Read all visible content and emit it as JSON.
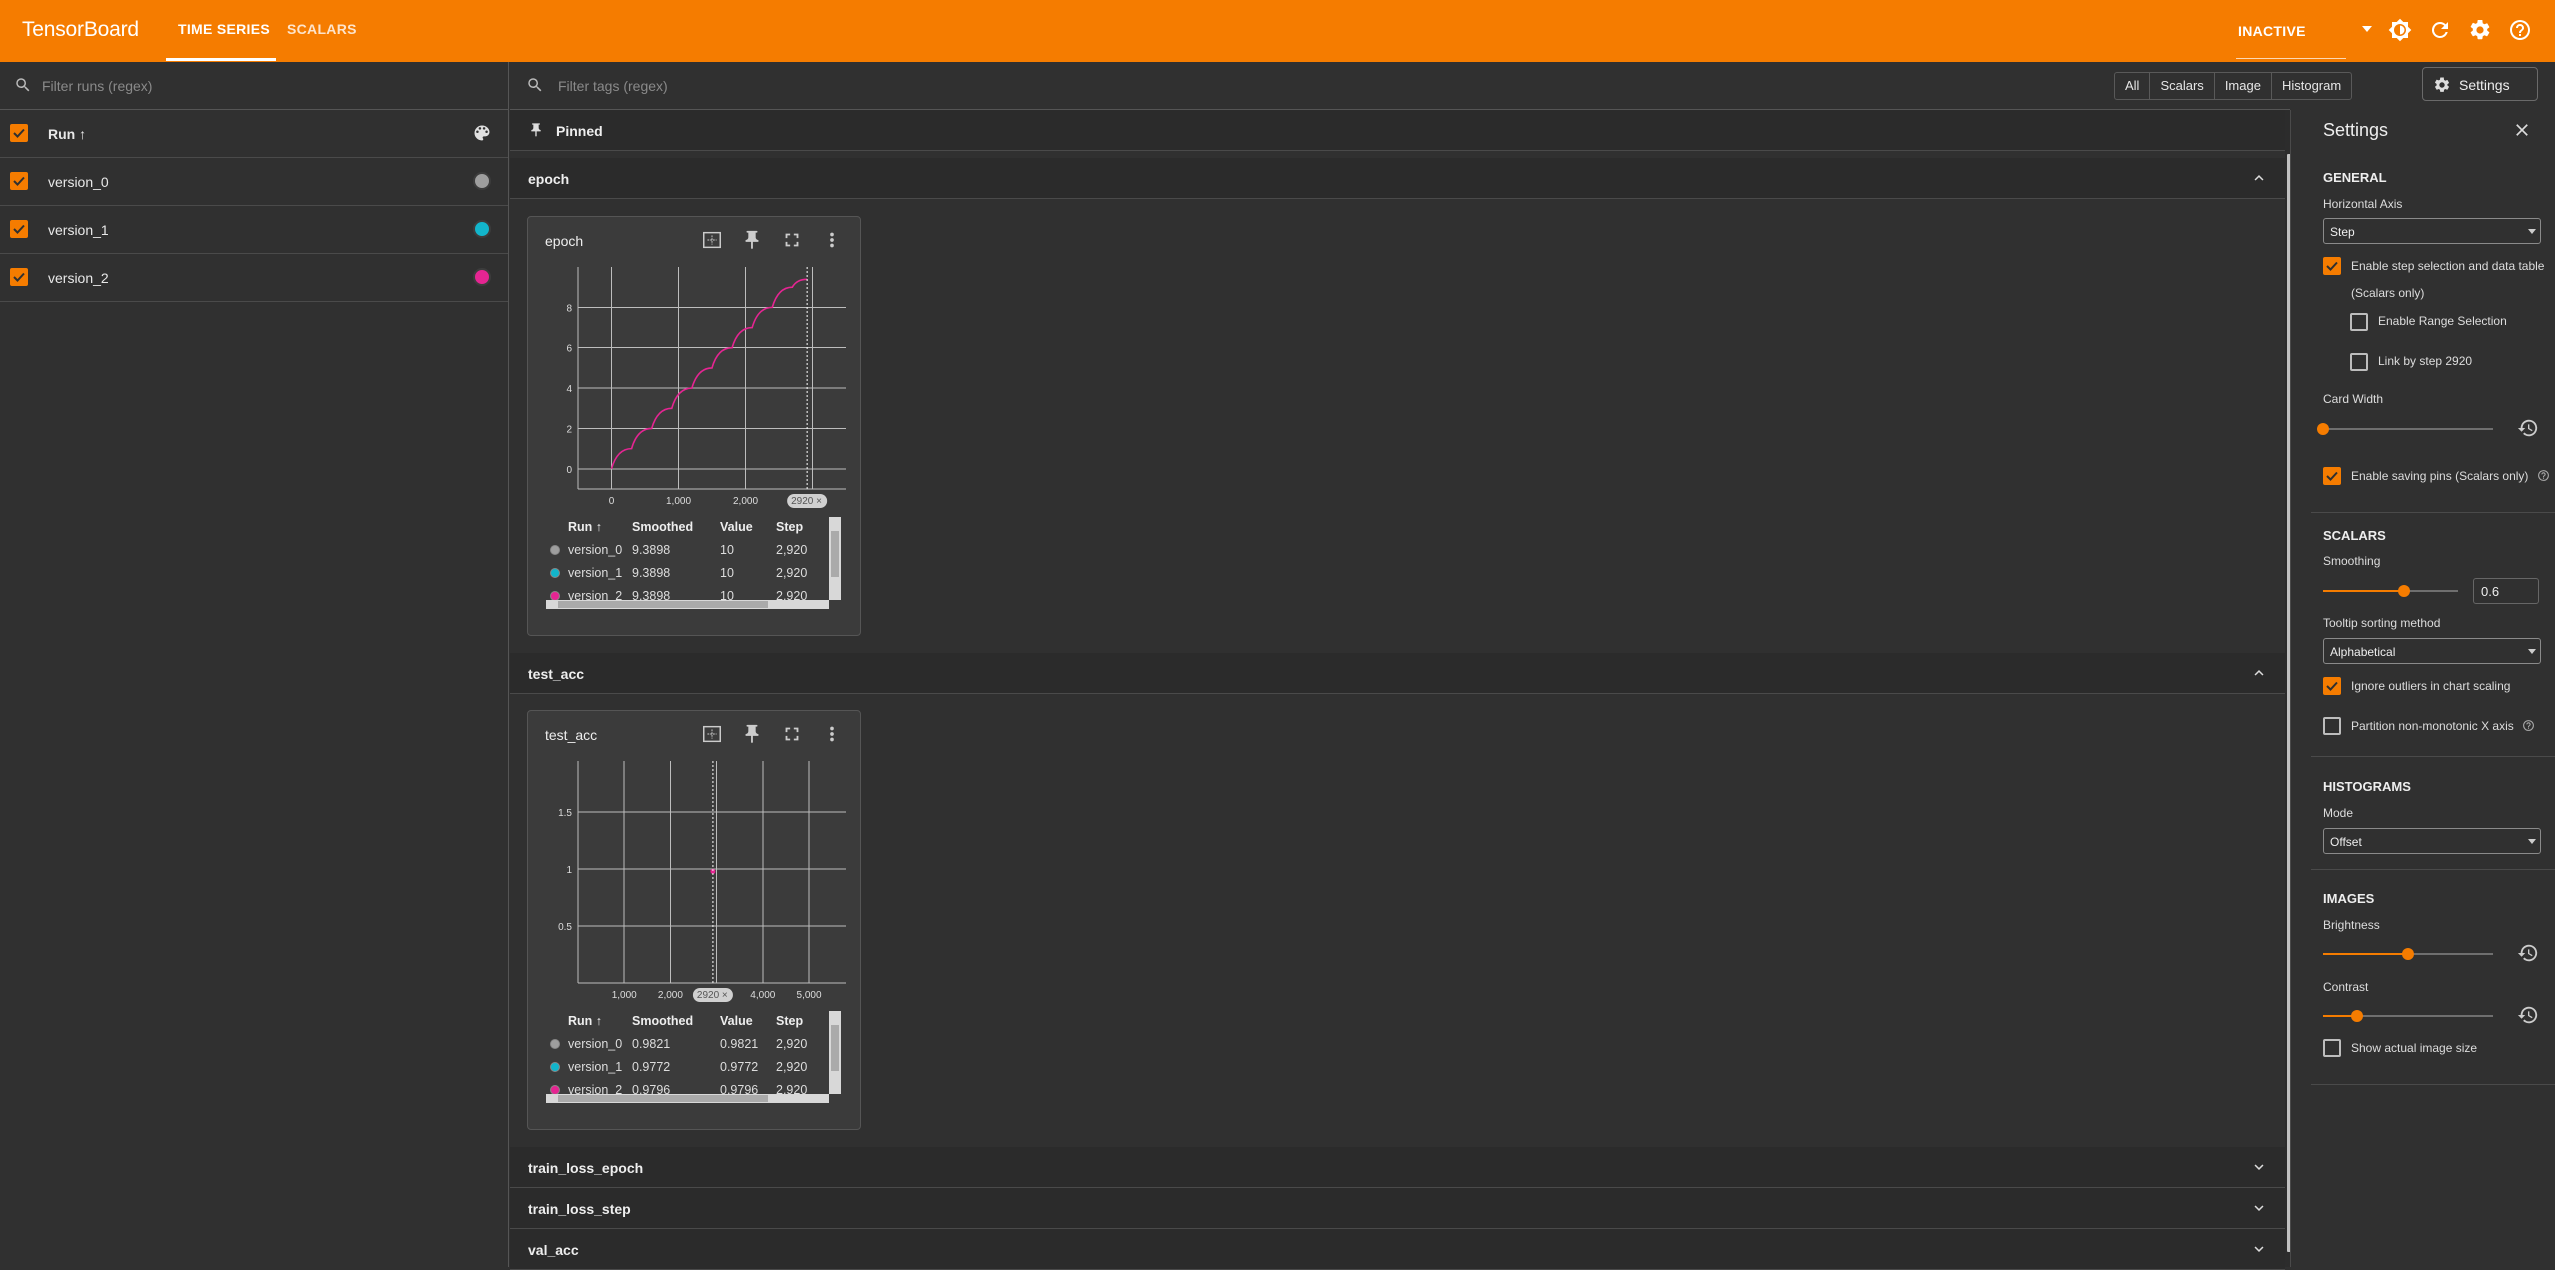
{
  "app": {
    "title": "TensorBoard"
  },
  "nav": {
    "tabs": [
      {
        "label": "TIME SERIES",
        "active": true
      },
      {
        "label": "SCALARS",
        "active": false
      }
    ]
  },
  "topbar": {
    "status": "INACTIVE",
    "icons": [
      "theme-toggle-icon",
      "refresh-icon",
      "settings-gear-icon",
      "help-icon"
    ]
  },
  "colors": {
    "accent": "#f57c00",
    "version_0": "#9e9e9e",
    "version_1": "#12b5cb",
    "version_2": "#e52592"
  },
  "runs": {
    "filter_placeholder": "Filter runs (regex)",
    "header": "Run ↑",
    "items": [
      {
        "name": "version_0",
        "color": "#9e9e9e"
      },
      {
        "name": "version_1",
        "color": "#12b5cb"
      },
      {
        "name": "version_2",
        "color": "#e52592"
      }
    ]
  },
  "main": {
    "filter_placeholder": "Filter tags (regex)",
    "type_filters": [
      "All",
      "Scalars",
      "Image",
      "Histogram"
    ],
    "settings_button": "Settings",
    "pinned_label": "Pinned",
    "groups": [
      "epoch",
      "test_acc",
      "train_loss_epoch",
      "train_loss_step",
      "val_acc"
    ]
  },
  "table": {
    "headers": [
      "Run ↑",
      "Smoothed",
      "Value",
      "Step"
    ]
  },
  "charts": [
    {
      "title": "epoch",
      "x_ticks": [
        "0",
        "1,000",
        "2,000"
      ],
      "y_ticks": [
        "0",
        "2",
        "4",
        "6",
        "8"
      ],
      "step_marker": "2920",
      "rows": [
        {
          "run": "version_0",
          "smoothed": "9.3898",
          "value": "10",
          "step": "2,920"
        },
        {
          "run": "version_1",
          "smoothed": "9.3898",
          "value": "10",
          "step": "2,920"
        },
        {
          "run": "version_2",
          "smoothed": "9.3898",
          "value": "10",
          "step": "2,920"
        }
      ]
    },
    {
      "title": "test_acc",
      "x_ticks": [
        "1,000",
        "2,000",
        "4,000",
        "5,000"
      ],
      "y_ticks": [
        "0.5",
        "1",
        "1.5"
      ],
      "step_marker": "2920",
      "rows": [
        {
          "run": "version_0",
          "smoothed": "0.9821",
          "value": "0.9821",
          "step": "2,920"
        },
        {
          "run": "version_1",
          "smoothed": "0.9772",
          "value": "0.9772",
          "step": "2,920"
        },
        {
          "run": "version_2",
          "smoothed": "0.9796",
          "value": "0.9796",
          "step": "2,920"
        }
      ]
    }
  ],
  "chart_data": [
    {
      "type": "line",
      "title": "epoch",
      "xlim": [
        -500,
        3500
      ],
      "ylim": [
        -1,
        10
      ],
      "step_selected": 2920,
      "series": [
        {
          "name": "version_2",
          "x": [
            0,
            300,
            600,
            900,
            1200,
            1500,
            1800,
            2100,
            2400,
            2700,
            2920
          ],
          "y": [
            0,
            1,
            2,
            3,
            4,
            5,
            6,
            7,
            8,
            9,
            9.39
          ]
        }
      ]
    },
    {
      "type": "scatter",
      "title": "test_acc",
      "xlim": [
        0,
        5800
      ],
      "ylim": [
        0,
        1.95
      ],
      "step_selected": 2920,
      "series": [
        {
          "name": "version_2",
          "x": [
            2920
          ],
          "y": [
            0.98
          ]
        }
      ]
    }
  ],
  "settings": {
    "title": "Settings",
    "general": {
      "section": "GENERAL",
      "horizontal_axis_label": "Horizontal Axis",
      "horizontal_axis_value": "Step",
      "step_selection": "Enable step selection and data table",
      "scalars_only": "(Scalars only)",
      "range_selection": "Enable Range Selection",
      "link_by_step": "Link by step 2920",
      "card_width": "Card Width",
      "card_width_level": 0,
      "saving_pins": "Enable saving pins (Scalars only)"
    },
    "scalars": {
      "section": "SCALARS",
      "smoothing_label": "Smoothing",
      "smoothing_value": "0.6",
      "tooltip_label": "Tooltip sorting method",
      "tooltip_value": "Alphabetical",
      "ignore_outliers": "Ignore outliers in chart scaling",
      "partition": "Partition non-monotonic X axis"
    },
    "histograms": {
      "section": "HISTOGRAMS",
      "mode_label": "Mode",
      "mode_value": "Offset"
    },
    "images": {
      "section": "IMAGES",
      "brightness": "Brightness",
      "brightness_level": 0.5,
      "contrast": "Contrast",
      "contrast_level": 0.2,
      "actual_size": "Show actual image size"
    }
  }
}
